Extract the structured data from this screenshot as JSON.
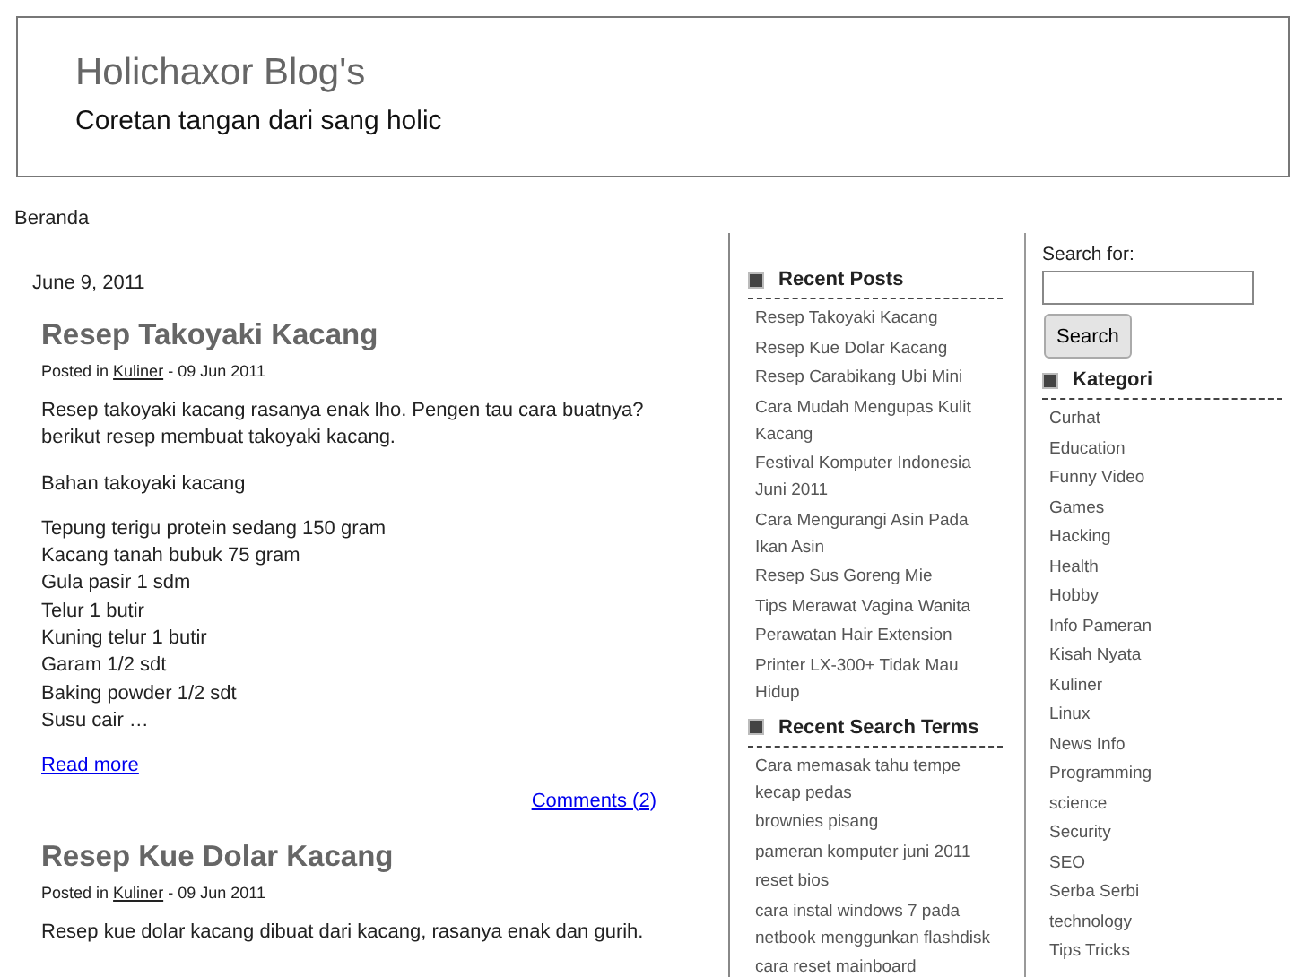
{
  "header": {
    "title": "Holichaxor Blog's",
    "tagline": "Coretan tangan dari sang holic"
  },
  "nav": [
    "Beranda"
  ],
  "main": {
    "date": "June 9, 2011",
    "posts": [
      {
        "title": "Resep Takoyaki Kacang",
        "posted_in": "Posted in",
        "category": "Kuliner",
        "date": "- 09 Jun 2011",
        "paragraphs": [
          [
            "Resep takoyaki kacang rasanya enak lho. Pengen tau cara buatnya? berikut resep membuat takoyaki kacang."
          ],
          [
            "Bahan takoyaki kacang"
          ],
          [
            "Tepung terigu protein sedang 150 gram",
            "Kacang tanah bubuk 75 gram",
            "Gula pasir 1 sdm",
            "Telur 1 butir",
            "Kuning telur 1 butir",
            "Garam 1/2 sdt",
            "Baking powder 1/2 sdt",
            "Susu cair …"
          ]
        ],
        "read_more": "Read more",
        "comments": "Comments (2)"
      },
      {
        "title": "Resep Kue Dolar Kacang",
        "posted_in": "Posted in",
        "category": "Kuliner",
        "date": "- 09 Jun 2011",
        "paragraphs": [
          [
            "Resep kue dolar kacang dibuat dari kacang, rasanya enak dan gurih."
          ]
        ]
      }
    ]
  },
  "sidebar": {
    "widgets": [
      {
        "title": "Recent Posts",
        "items": [
          "Resep Takoyaki Kacang",
          "Resep Kue Dolar Kacang",
          "Resep Carabikang Ubi Mini",
          "Cara Mudah Mengupas Kulit Kacang",
          "Festival Komputer Indonesia Juni 2011",
          "Cara Mengurangi Asin Pada Ikan Asin",
          "Resep Sus Goreng Mie",
          "Tips Merawat Vagina Wanita",
          "Perawatan Hair Extension",
          "Printer LX-300+ Tidak Mau Hidup"
        ]
      },
      {
        "title": "Recent Search Terms",
        "items": [
          "Cara memasak tahu tempe kecap pedas",
          "brownies pisang",
          "pameran komputer juni 2011",
          "reset bios",
          "cara instal windows 7 pada netbook menggunkan flashdisk",
          "cara reset mainboard"
        ]
      }
    ]
  },
  "right": {
    "search_label": "Search for:",
    "search_button": "Search",
    "widgets": [
      {
        "title": "Kategori",
        "items": [
          "Curhat",
          "Education",
          "Funny Video",
          "Games",
          "Hacking",
          "Health",
          "Hobby",
          "Info Pameran",
          "Kisah Nyata",
          "Kuliner",
          "Linux",
          "News Info",
          "Programming",
          "science",
          "Security",
          "SEO",
          "Serba Serbi",
          "technology",
          "Tips Tricks"
        ]
      }
    ]
  }
}
